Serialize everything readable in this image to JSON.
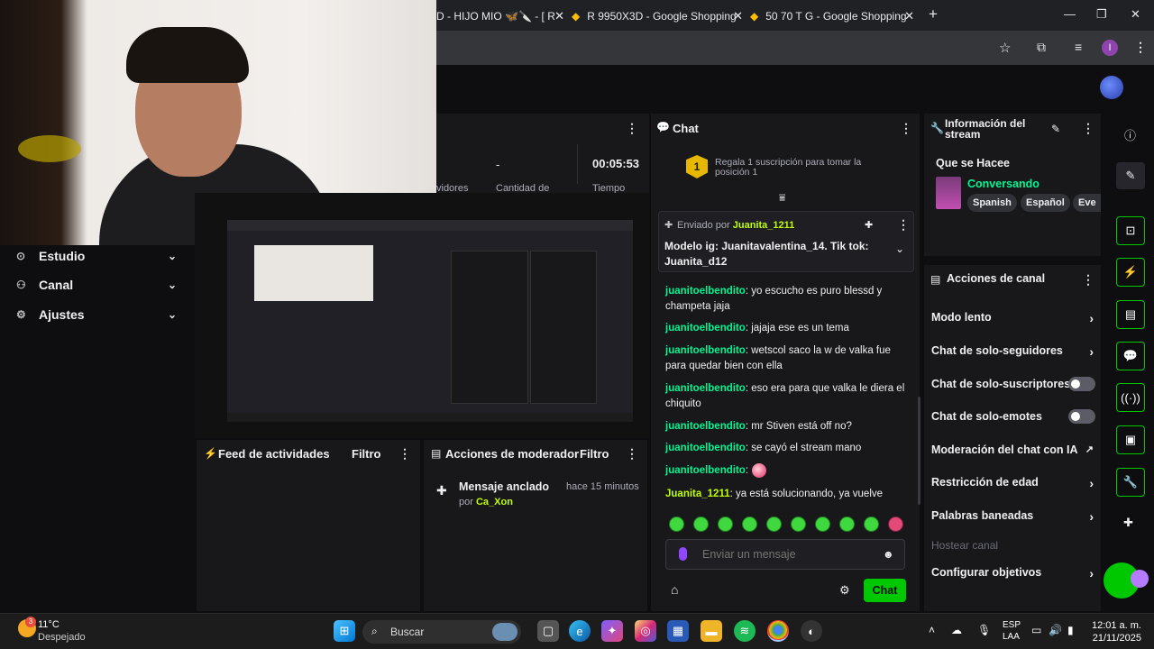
{
  "browser": {
    "tabs": [
      {
        "label": "D - HIJO MIO 🦋🔪 - [ R",
        "close": "✕"
      },
      {
        "label": "R 9950X3D - Google Shopping",
        "close": "✕"
      },
      {
        "label": "50 70 T G - Google Shopping",
        "close": "✕"
      }
    ],
    "new_tab": "+",
    "profile_initial": "I"
  },
  "left_nav": {
    "items": [
      {
        "label": "Estudio",
        "icon": "studio-icon"
      },
      {
        "label": "Canal",
        "icon": "channel-icon"
      },
      {
        "label": "Ajustes",
        "icon": "gear-icon"
      }
    ]
  },
  "stream_stats": {
    "value_dash": "-",
    "timer": "00:05:53",
    "partial_labels": [
      "vidores",
      "Cantidad de",
      "Tiempo"
    ]
  },
  "chat": {
    "title": "Chat",
    "promo": {
      "rank": "1",
      "text": "Regala 1 suscripción para tomar la posición 1"
    },
    "pinned": {
      "sent_by_prefix": "Enviado por",
      "sent_by_user": "Juanita_1211",
      "text": "Modelo ig: Juanitavalentina_14. Tik tok: Juanita_d12"
    },
    "messages": [
      {
        "user": "juanitoelbendito",
        "text": ": yo escucho es puro blessd y champeta jaja"
      },
      {
        "user": "juanitoelbendito",
        "text": ": jajaja ese es un tema"
      },
      {
        "user": "juanitoelbendito",
        "text": ": wetscol saco la w de valka fue para quedar bien con ella"
      },
      {
        "user": "juanitoelbendito",
        "text": ": eso era para que valka le diera el chiquito"
      },
      {
        "user": "juanitoelbendito",
        "text": ": mr Stiven está off no?"
      },
      {
        "user": "juanitoelbendito",
        "text": ": se cayó el stream mano"
      },
      {
        "user": "juanitoelbendito",
        "text": ":"
      },
      {
        "user": "Juanita_1211",
        "text": ": ya está solucionando, ya vuelve"
      }
    ],
    "input_placeholder": "Enviar un mensaje",
    "send_label": "Chat"
  },
  "stream_info": {
    "title": "Información del stream",
    "stream_title": "Que se Hacee",
    "category": "Conversando",
    "tags": [
      "Spanish",
      "Español",
      "Eve"
    ]
  },
  "channel_actions": {
    "title": "Acciones de canal",
    "items": [
      {
        "label": "Modo lento",
        "control": "arrow"
      },
      {
        "label": "Chat de solo-seguidores",
        "control": "arrow"
      },
      {
        "label": "Chat de solo-suscriptores",
        "control": "toggle"
      },
      {
        "label": "Chat de solo-emotes",
        "control": "toggle"
      },
      {
        "label": "Moderación del chat con IA",
        "control": "external"
      },
      {
        "label": "Restricción de edad",
        "control": "arrow"
      },
      {
        "label": "Palabras baneadas",
        "control": "arrow"
      },
      {
        "label": "Hostear canal",
        "control": "none"
      },
      {
        "label": "Configurar objetivos",
        "control": "arrow"
      }
    ]
  },
  "activity_feed": {
    "title": "Feed de actividades",
    "filter": "Filtro"
  },
  "mod_actions": {
    "title": "Acciones de moderador",
    "filter": "Filtro",
    "entry": {
      "title": "Mensaje anclado",
      "by_prefix": "por",
      "by_user": "Ca_Xon",
      "time": "hace 15 minutos"
    }
  },
  "taskbar": {
    "weather_temp": "11°C",
    "weather_desc": "Despejado",
    "weather_badge": "3",
    "search_label": "Buscar",
    "lang_1": "ESP",
    "lang_2": "LAA",
    "time": "12:01 a. m.",
    "date": "21/11/2025"
  },
  "colors": {
    "accent_green": "#00f593",
    "brand": "#00c800",
    "bg": "#0e0e10",
    "panel": "#18181b"
  }
}
